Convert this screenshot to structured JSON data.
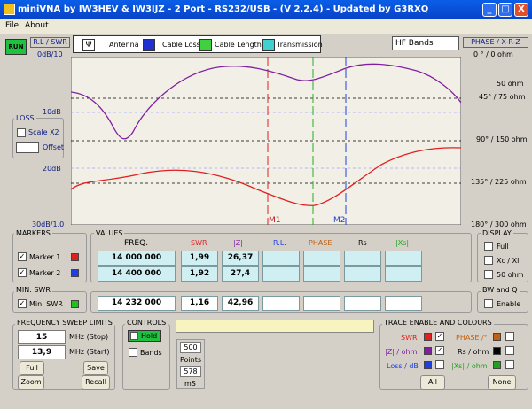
{
  "window": {
    "title": "miniVNA by IW3HEV & IW3IJZ - 2 Port - RS232/USB -  (V 2.2.4) - Updated by G3RXQ",
    "min": "_",
    "max": "□",
    "close": "X"
  },
  "menu": {
    "file": "File",
    "about": "About"
  },
  "toolbar": {
    "run": "RUN",
    "rl_swr": "R.L / SWR",
    "antenna": "Antenna",
    "cable_loss": "Cable Loss",
    "cable_length": "Cable Length",
    "transmission": "Transmission",
    "band": "HF Bands",
    "phase_title": "PHASE / X-R-Z"
  },
  "left_axis": {
    "top": "0dB/10",
    "mid1": "10dB",
    "mid2": "20dB",
    "bottom": "30dB/1.0"
  },
  "right_axis": {
    "r1": "0 ° / 0 ohm",
    "r2": "50 ohm",
    "r3": "45° / 75 ohm",
    "r4": "90° / 150 ohm",
    "r5": "135° / 225 ohm",
    "r6": "180° / 300 ohm"
  },
  "loss": {
    "title": "LOSS",
    "scale": "Scale X2",
    "offset": "Offset"
  },
  "chart_markers": {
    "m1": "M1",
    "m2": "M2"
  },
  "markers": {
    "title": "MARKERS",
    "m1": "Marker 1",
    "m2": "Marker 2"
  },
  "values": {
    "title": "VALUES",
    "col_freq": "FREQ.",
    "col_swr": "SWR",
    "col_z": "|Z|",
    "col_rl": "R.L.",
    "col_phase": "PHASE",
    "col_rs": "Rs",
    "col_xs": "|Xs|",
    "m1_freq": "14 000 000",
    "m1_swr": "1,99",
    "m1_z": "26,37",
    "m2_freq": "14 400 000",
    "m2_swr": "1,92",
    "m2_z": "27,4",
    "min_freq": "14 232 000",
    "min_swr": "1,16",
    "min_z": "42,96"
  },
  "minswr": {
    "title": "MIN. SWR",
    "label": "Min. SWR"
  },
  "display": {
    "title": "DISPLAY",
    "full": "Full",
    "xc": "Xc / Xl",
    "ohm50": "50 ohm"
  },
  "bwq": {
    "title": "BW and Q",
    "enable": "Enable"
  },
  "sweep": {
    "title": "FREQUENCY SWEEP LIMITS",
    "stop_val": "15",
    "stop_unit": "MHz (Stop)",
    "start_val": "13,9",
    "start_unit": "MHz (Start)",
    "full": "Full",
    "save": "Save",
    "zoom": "Zoom",
    "recall": "Recall"
  },
  "controls": {
    "title": "CONTROLS",
    "hold": "Hold",
    "bands": "Bands",
    "points_val": "500",
    "points_label": "Points",
    "ms_val": "578",
    "ms_label": "mS"
  },
  "trace": {
    "title": "TRACE ENABLE AND COLOURS",
    "swr": "SWR",
    "phase": "PHASE /°",
    "z": "|Z| / ohm",
    "rs": "Rs / ohm",
    "loss": "Loss / dB",
    "xs": "|Xs| / ohm",
    "all": "All",
    "none": "None"
  },
  "colors": {
    "swr": "#e02020",
    "z": "#8020a0",
    "loss": "#2040e0",
    "phase": "#c06010",
    "rs": "#000000",
    "xs": "#20a020"
  }
}
